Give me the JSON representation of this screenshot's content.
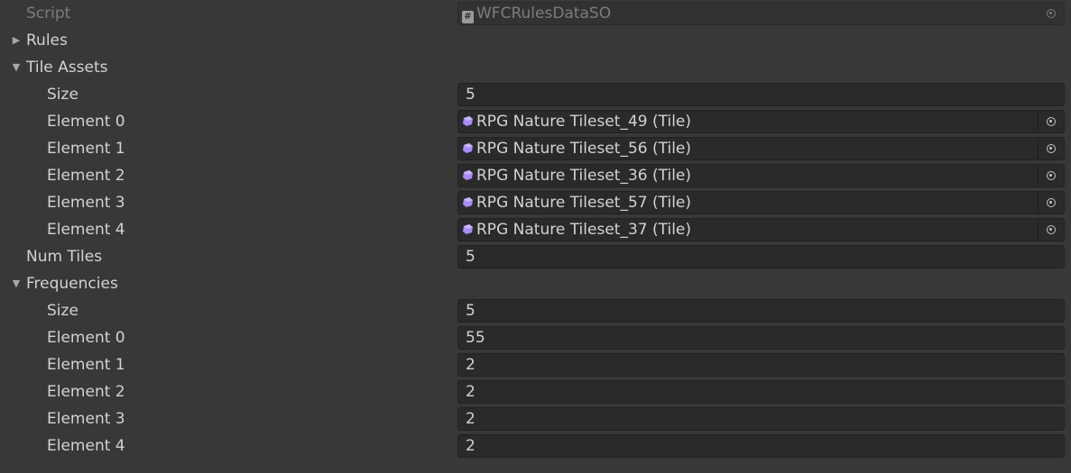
{
  "script": {
    "label": "Script",
    "value": "WFCRulesDataSO",
    "icon": "script-icon"
  },
  "rules": {
    "label": "Rules",
    "expanded": false
  },
  "tile_assets": {
    "label": "Tile Assets",
    "expanded": true,
    "size_label": "Size",
    "size": "5",
    "elements": [
      {
        "label": "Element 0",
        "value": "RPG Nature Tileset_49 (Tile)"
      },
      {
        "label": "Element 1",
        "value": "RPG Nature Tileset_56 (Tile)"
      },
      {
        "label": "Element 2",
        "value": "RPG Nature Tileset_36 (Tile)"
      },
      {
        "label": "Element 3",
        "value": "RPG Nature Tileset_57 (Tile)"
      },
      {
        "label": "Element 4",
        "value": "RPG Nature Tileset_37 (Tile)"
      }
    ]
  },
  "num_tiles": {
    "label": "Num Tiles",
    "value": "5"
  },
  "frequencies": {
    "label": "Frequencies",
    "expanded": true,
    "size_label": "Size",
    "size": "5",
    "elements": [
      {
        "label": "Element 0",
        "value": "55"
      },
      {
        "label": "Element 1",
        "value": "2"
      },
      {
        "label": "Element 2",
        "value": "2"
      },
      {
        "label": "Element 3",
        "value": "2"
      },
      {
        "label": "Element 4",
        "value": "2"
      }
    ]
  },
  "icons": {
    "foldout_collapsed": "▶",
    "foldout_expanded": "▼",
    "tile_asset_icon": "tile-asset-icon",
    "object_picker_icon": "object-picker-icon"
  },
  "colors": {
    "background": "#383838",
    "field_bg": "#2a2a2a",
    "text": "#d2d2d2",
    "disabled_text": "#7c7c7c",
    "tile_icon": "#a98bff"
  }
}
